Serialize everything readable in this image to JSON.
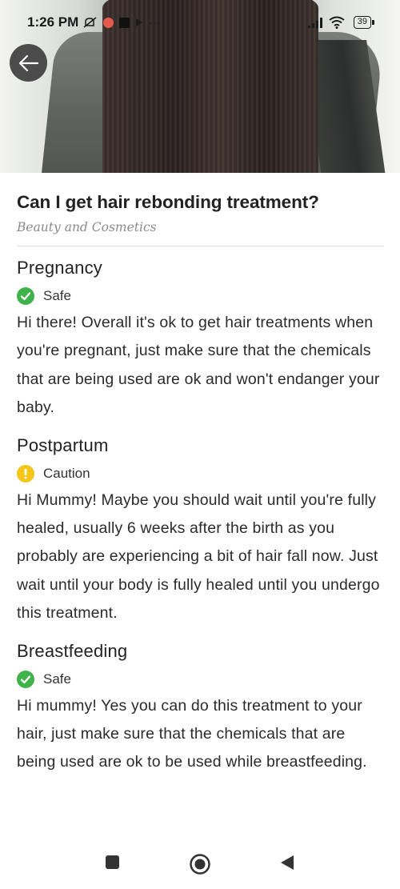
{
  "status_bar": {
    "time": "1:26 PM",
    "overflow": "···",
    "battery": "39"
  },
  "header": {
    "title": "Can I get hair rebonding treatment?",
    "category": "Beauty and Cosmetics"
  },
  "sections": [
    {
      "heading": "Pregnancy",
      "status": "Safe",
      "status_icon": "check-circle-icon",
      "status_color": "#3fb24a",
      "text": "Hi there! Overall it's ok to get hair treatments when you're pregnant, just make sure that the chemicals that are being used are ok and won't endanger your baby."
    },
    {
      "heading": "Postpartum",
      "status": "Caution",
      "status_icon": "exclamation-circle-icon",
      "status_color": "#f5c518",
      "text": "Hi Mummy! Maybe you should wait until you're fully healed, usually 6 weeks after the birth as you probably are experiencing a bit of hair fall now. Just wait until your body is fully healed until you undergo this treatment."
    },
    {
      "heading": "Breastfeeding",
      "status": "Safe",
      "status_icon": "check-circle-icon",
      "status_color": "#3fb24a",
      "text": "Hi mummy! Yes you can do this treatment to your hair, just make sure that the chemicals that are being used are ok to be used while breastfeeding."
    }
  ],
  "nav": {
    "recents_icon": "square-icon",
    "home_icon": "circle-home-icon",
    "back_icon": "triangle-back-icon"
  }
}
